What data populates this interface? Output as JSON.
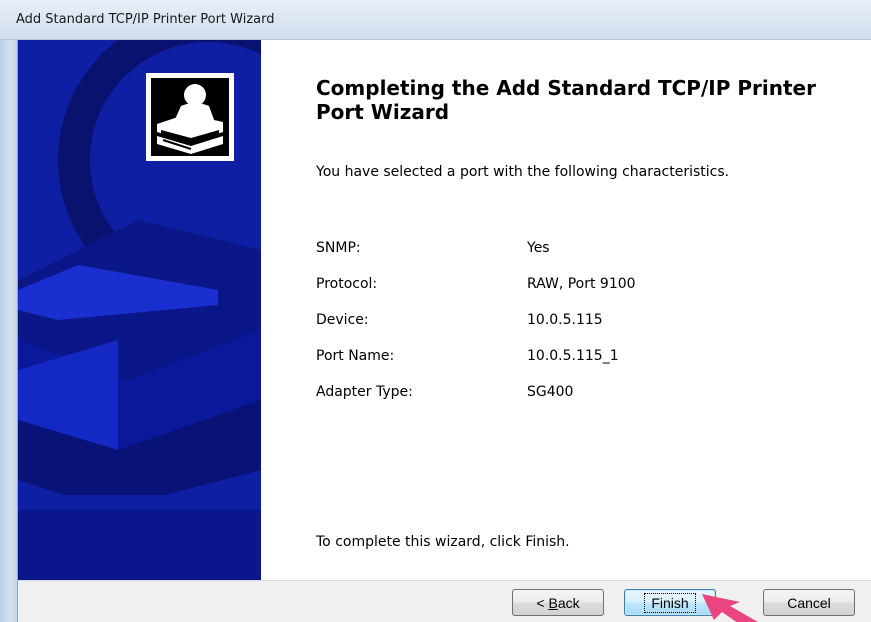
{
  "window": {
    "title": "Add Standard TCP/IP Printer Port Wizard"
  },
  "main": {
    "heading": "Completing the Add Standard TCP/IP Printer Port Wizard",
    "subtitle": "You have selected a port with the following characteristics.",
    "properties": [
      {
        "label": "SNMP:",
        "value": "Yes"
      },
      {
        "label": "Protocol:",
        "value": "RAW, Port 9100"
      },
      {
        "label": "Device:",
        "value": "10.0.5.115"
      },
      {
        "label": "Port Name:",
        "value": "10.0.5.115_1"
      },
      {
        "label": "Adapter Type:",
        "value": "SG400"
      }
    ],
    "footer_text": "To complete this wizard, click Finish."
  },
  "buttons": {
    "back_prefix": "< ",
    "back_mnemonic": "B",
    "back_rest": "ack",
    "finish": "Finish",
    "cancel": "Cancel"
  },
  "icons": {
    "wizard_logo": "printer-wizard-icon",
    "pointer": "arrow-pointer-icon"
  },
  "colors": {
    "side_panel": "#0f1fa3",
    "pointer": "#e94580",
    "finish_border": "#3c7fb1"
  }
}
